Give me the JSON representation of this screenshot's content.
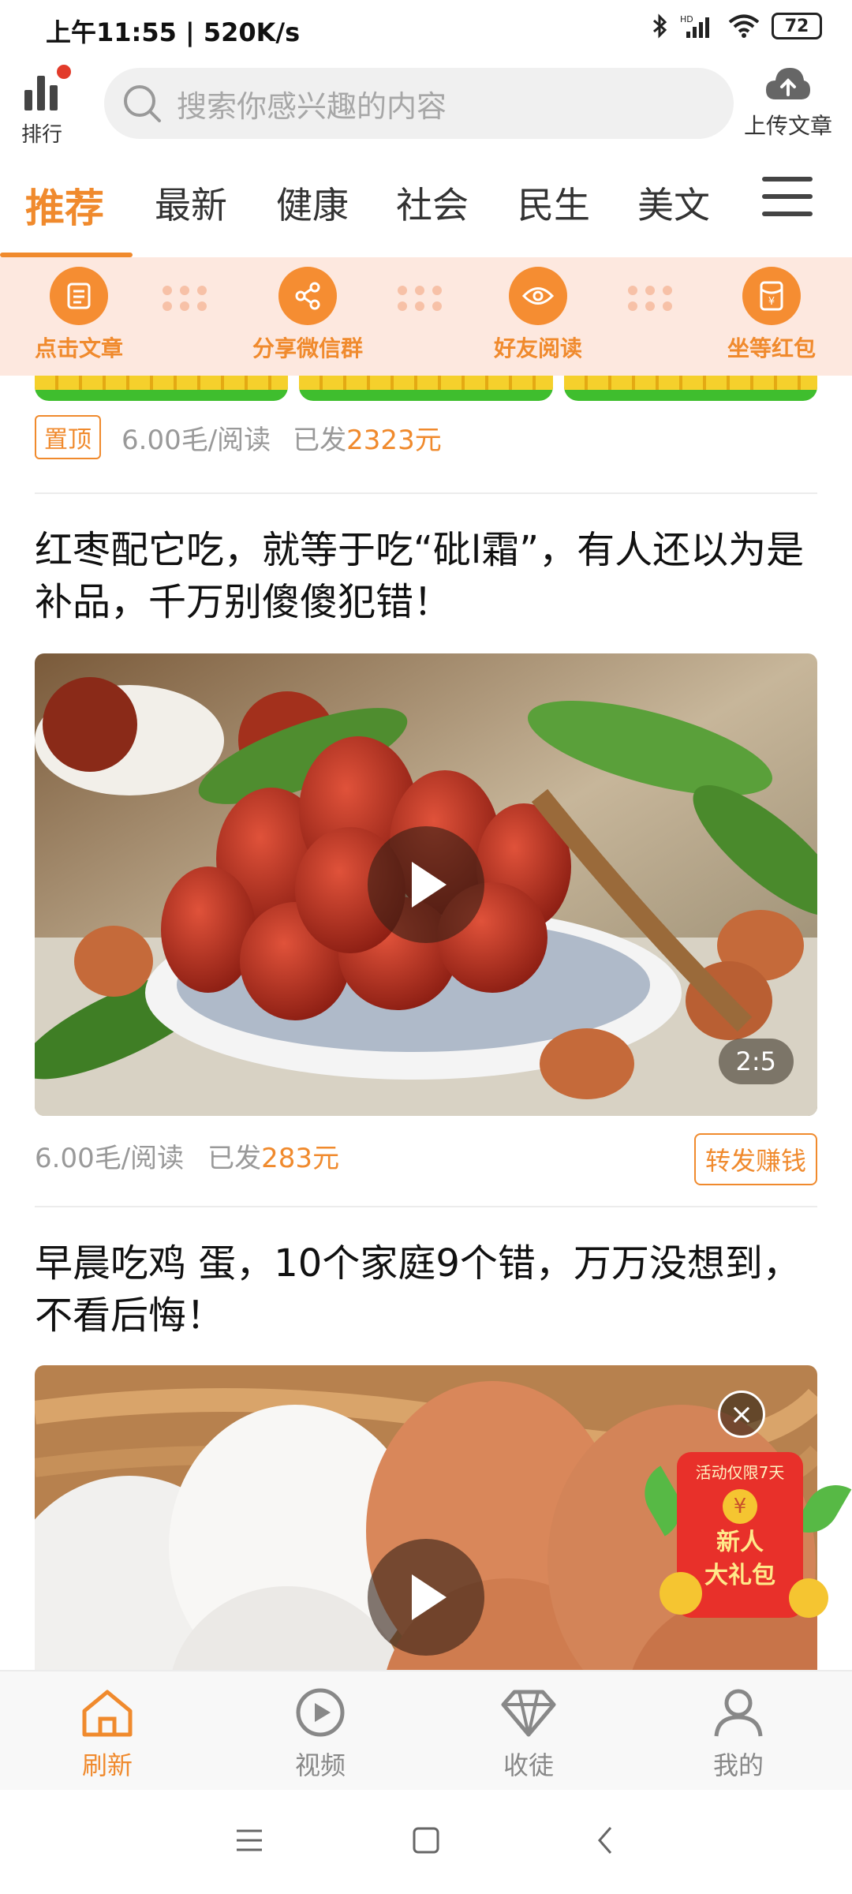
{
  "status_bar": {
    "time": "上午11:55 | 520K/s",
    "icons": [
      "bluetooth-icon",
      "hd-signal-icon",
      "wifi-icon"
    ],
    "battery": "72"
  },
  "top_bar": {
    "rank_label": "排行",
    "search_placeholder": "搜索你感兴趣的内容",
    "upload_label": "上传文章"
  },
  "tabs": [
    "推荐",
    "最新",
    "健康",
    "社会",
    "民生",
    "美文"
  ],
  "steps": [
    {
      "label": "点击文章",
      "icon": "article-icon"
    },
    {
      "label": "分享微信群",
      "icon": "share-icon"
    },
    {
      "label": "好友阅读",
      "icon": "eye-icon"
    },
    {
      "label": "坐等红包",
      "icon": "red-packet-icon"
    }
  ],
  "feed": {
    "pinned_item": {
      "badge": "置顶",
      "rate": "6.00毛/阅读",
      "paid_prefix": "已发",
      "paid_amount": "2323元"
    },
    "articles": [
      {
        "title": "红枣配它吃，就等于吃“砒l霜”，有人还以为是补品，千万别傻傻犯错！",
        "duration": "2:5",
        "rate": "6.00毛/阅读",
        "paid_prefix": "已发",
        "paid_amount": "283元",
        "action": "转发赚钱"
      },
      {
        "title": "早晨吃鸡 蛋，10个家庭9个错，万万没想到，不看后悔！"
      }
    ]
  },
  "promo": {
    "close": "×",
    "ribbon": "活动仅限7天",
    "coin": "¥",
    "line1": "新人",
    "line2": "大礼包"
  },
  "bottom_nav": [
    {
      "label": "刷新",
      "icon": "home-icon",
      "active": true
    },
    {
      "label": "视频",
      "icon": "video-icon",
      "active": false
    },
    {
      "label": "收徒",
      "icon": "diamond-icon",
      "active": false
    },
    {
      "label": "我的",
      "icon": "user-icon",
      "active": false
    }
  ],
  "colors": {
    "accent": "#f08a2d",
    "banner_bg": "#fde8df",
    "promo_red": "#e8302a"
  }
}
